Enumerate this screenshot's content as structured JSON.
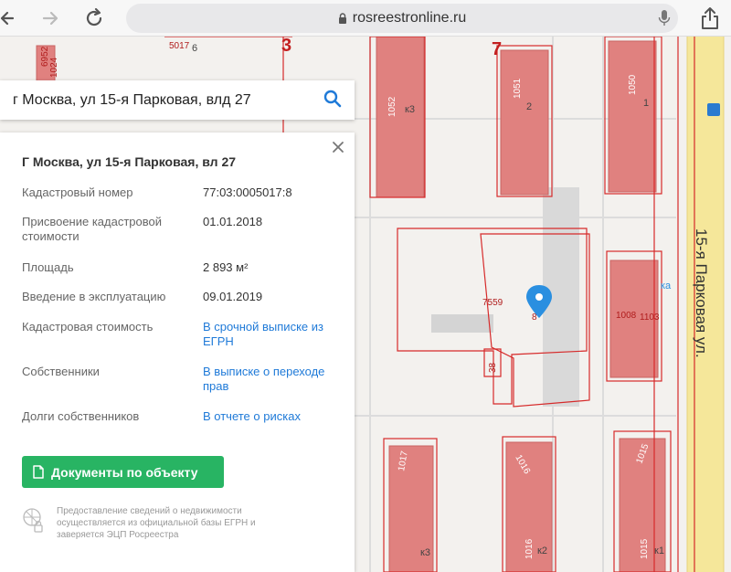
{
  "browser": {
    "url": "rosreestronline.ru",
    "icons": [
      "back-icon",
      "forward-icon",
      "reload-icon",
      "lock-icon",
      "microphone-icon",
      "share-icon"
    ]
  },
  "search": {
    "value": "г Москва, ул 15-я Парковая, влд 27"
  },
  "panel": {
    "title": "Г Москва, ул 15-я Парковая, вл 27",
    "rows": [
      {
        "label": "Кадастровый номер",
        "value": "77:03:0005017:8"
      },
      {
        "label": "Присвоение кадастровой стоимости",
        "value": "01.01.2018"
      },
      {
        "label": "Площадь",
        "value": "2 893 м²"
      },
      {
        "label": "Введение в эксплуатацию",
        "value": "09.01.2019"
      },
      {
        "label": "Кадастровая стоимость",
        "value": "В срочной выписке из ЕГРН"
      },
      {
        "label": "Собственники",
        "value": "В выписке о переходе прав"
      },
      {
        "label": "Долги собственников",
        "value": "В отчете о рисках"
      }
    ],
    "button_label": "Документы по объекту",
    "disclaimer": "Предоставление сведений о недвижимости осуществляется из официальной базы ЕГРН и заверяется ЭЦП Росреестра"
  },
  "map": {
    "street_label": "15-я Парковая ул.",
    "parcel_numbers": [
      "5017",
      "6952",
      "1024",
      "1052",
      "1051",
      "1050",
      "7559",
      "8",
      "38",
      "1008",
      "1103",
      "1017",
      "1016",
      "1015"
    ],
    "house_labels": [
      "к3",
      "2",
      "1",
      "к3",
      "к2",
      "к1",
      "6",
      "3",
      "7",
      "ка",
      "17"
    ],
    "colors": {
      "building": "#e0817f",
      "parcel_line": "#d62a2a",
      "road": "#f5e79a",
      "background": "#f3f1ee",
      "marker": "#2a8fe0"
    }
  }
}
